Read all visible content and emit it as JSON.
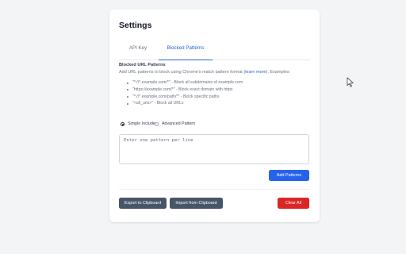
{
  "settings": {
    "title": "Settings",
    "tabs": [
      {
        "label": "API Key",
        "active": false
      },
      {
        "label": "Blocked Patterns",
        "active": true
      }
    ],
    "section_title": "Blocked URL Patterns",
    "description_before": "Add URL patterns to block using Chrome's match pattern format (",
    "description_link": "learn more",
    "description_after": "). Examples:",
    "examples": [
      "\"*://*.example.com/*\" - Block all subdomains of example.com",
      "\"https://example.com/*\" - Block exact domain with https",
      "\"*://*.example.com/path/*\" - Block specific paths",
      "\"<all_urls>\" - Block all URLs"
    ],
    "mode_options": [
      {
        "label": "Simple Include",
        "selected": true
      },
      {
        "label": "Advanced Pattern",
        "selected": false
      }
    ],
    "pattern_input": {
      "value": "",
      "placeholder": "Enter one pattern per line"
    },
    "add_button": "Add Patterns",
    "export_button": "Export to Clipboard",
    "import_button": "Import from Clipboard",
    "clear_button": "Clear All"
  },
  "colors": {
    "primary": "#2563eb",
    "secondary": "#475569",
    "danger": "#dc2626",
    "background": "#f3f4f6",
    "card": "#ffffff"
  },
  "icons": {
    "cursor": "mouse-pointer-icon"
  }
}
